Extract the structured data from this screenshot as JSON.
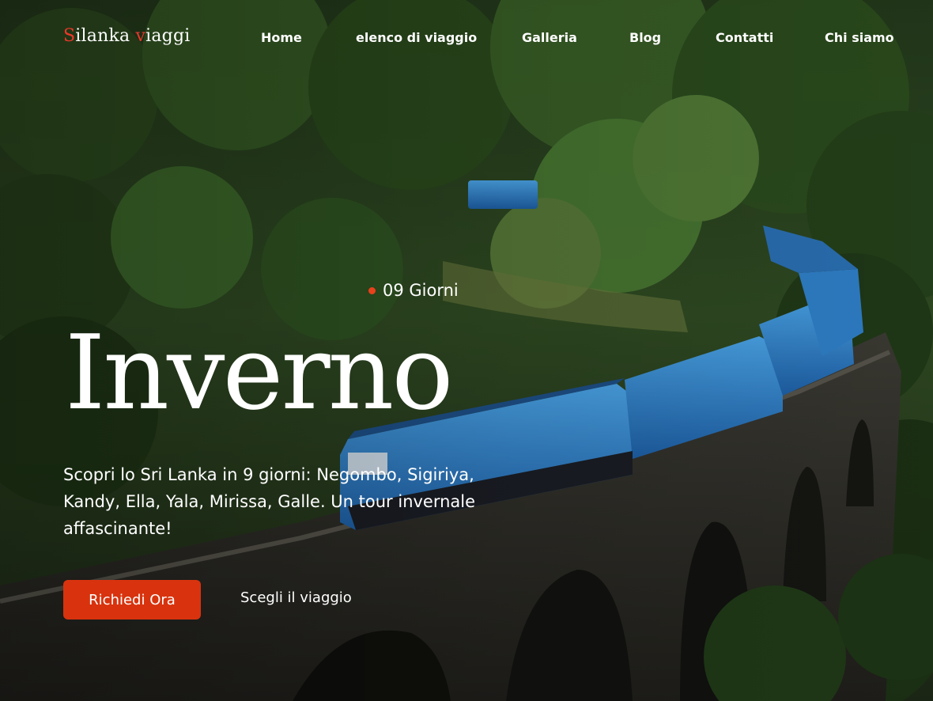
{
  "brand": {
    "logo_first_letter": "S",
    "logo_first_rest": "ilanka ",
    "logo_second_letter": "v",
    "logo_second_rest": "iaggi",
    "accent_color": "#e8392a"
  },
  "nav": {
    "items": [
      {
        "label": "Home"
      },
      {
        "label": "elenco di viaggio"
      },
      {
        "label": "Galleria"
      },
      {
        "label": "Blog"
      },
      {
        "label": "Contatti"
      },
      {
        "label": "Chi siamo"
      }
    ]
  },
  "hero": {
    "duration": "09 Giorni",
    "title": "Inverno",
    "description": "Scopri lo Sri Lanka in 9 giorni: Negombo, Sigiriya, Kandy, Ella, Yala, Mirissa, Galle. Un tour invernale affascinante!",
    "primary_button": "Richiedi Ora",
    "secondary_button": "Scegli il viaggio",
    "button_color": "#d8330e"
  }
}
